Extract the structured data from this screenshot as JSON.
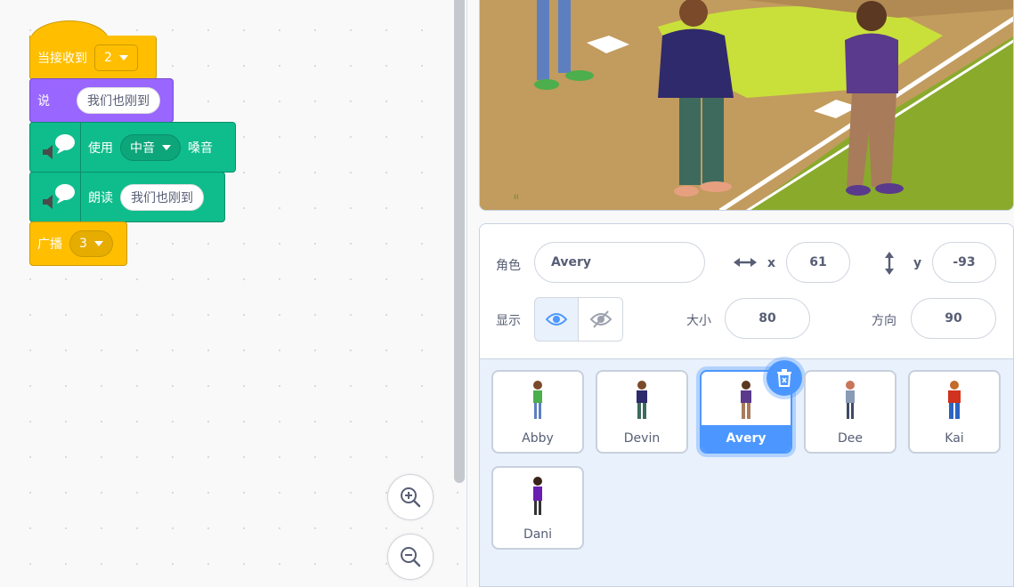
{
  "blocks": {
    "hat": {
      "label": "当接收到",
      "message": "2"
    },
    "say": {
      "label": "说",
      "text": "我们也刚到"
    },
    "voice": {
      "label": "使用",
      "voice_option": "中音",
      "suffix": "嗓音"
    },
    "speak": {
      "label": "朗读",
      "text": "我们也刚到"
    },
    "broadcast": {
      "label": "广播",
      "message": "3"
    }
  },
  "zoom": {
    "in_icon": "zoom-in-icon",
    "out_icon": "zoom-out-icon"
  },
  "sprite_info": {
    "sprite_label": "角色",
    "sprite_name": "Avery",
    "x_label": "x",
    "x_value": "61",
    "y_label": "y",
    "y_value": "-93",
    "show_label": "显示",
    "size_label": "大小",
    "size_value": "80",
    "direction_label": "方向",
    "direction_value": "90"
  },
  "sprites": [
    {
      "name": "Abby",
      "selected": false
    },
    {
      "name": "Devin",
      "selected": false
    },
    {
      "name": "Avery",
      "selected": true
    },
    {
      "name": "Dee",
      "selected": false
    },
    {
      "name": "Kai",
      "selected": false
    },
    {
      "name": "Dani",
      "selected": false
    }
  ],
  "colors": {
    "events": "#ffbf00",
    "looks": "#9966ff",
    "extension": "#0fbd8c",
    "accent": "#4c97ff"
  }
}
